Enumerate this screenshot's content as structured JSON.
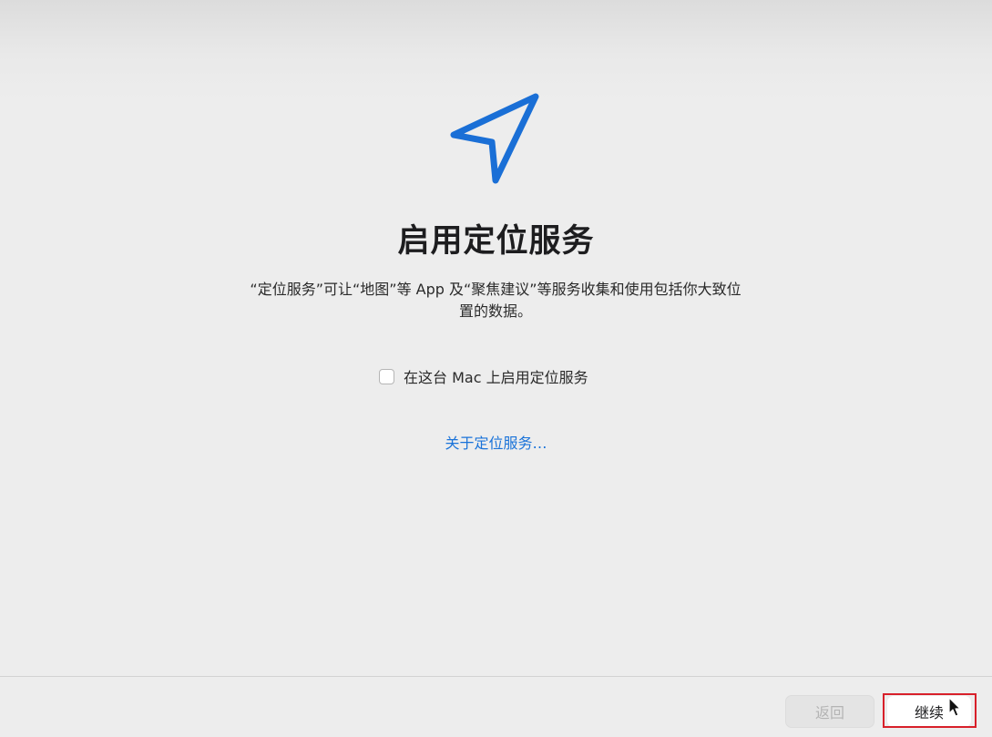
{
  "icons": {
    "hero": "location-arrow-icon",
    "cursor": "mouse-pointer-icon"
  },
  "colors": {
    "accent": "#1a73d9",
    "icon_blue": "#1a6fd6",
    "highlight": "#d8202a"
  },
  "main": {
    "title": "启用定位服务",
    "description": "“定位服务”可让“地图”等 App 及“聚焦建议”等服务收集和使用包括你大致位置的数据。",
    "checkbox": {
      "label": "在这台 Mac 上启用定位服务",
      "checked": false
    },
    "link": "关于定位服务…"
  },
  "footer": {
    "back_label": "返回",
    "continue_label": "继续"
  }
}
